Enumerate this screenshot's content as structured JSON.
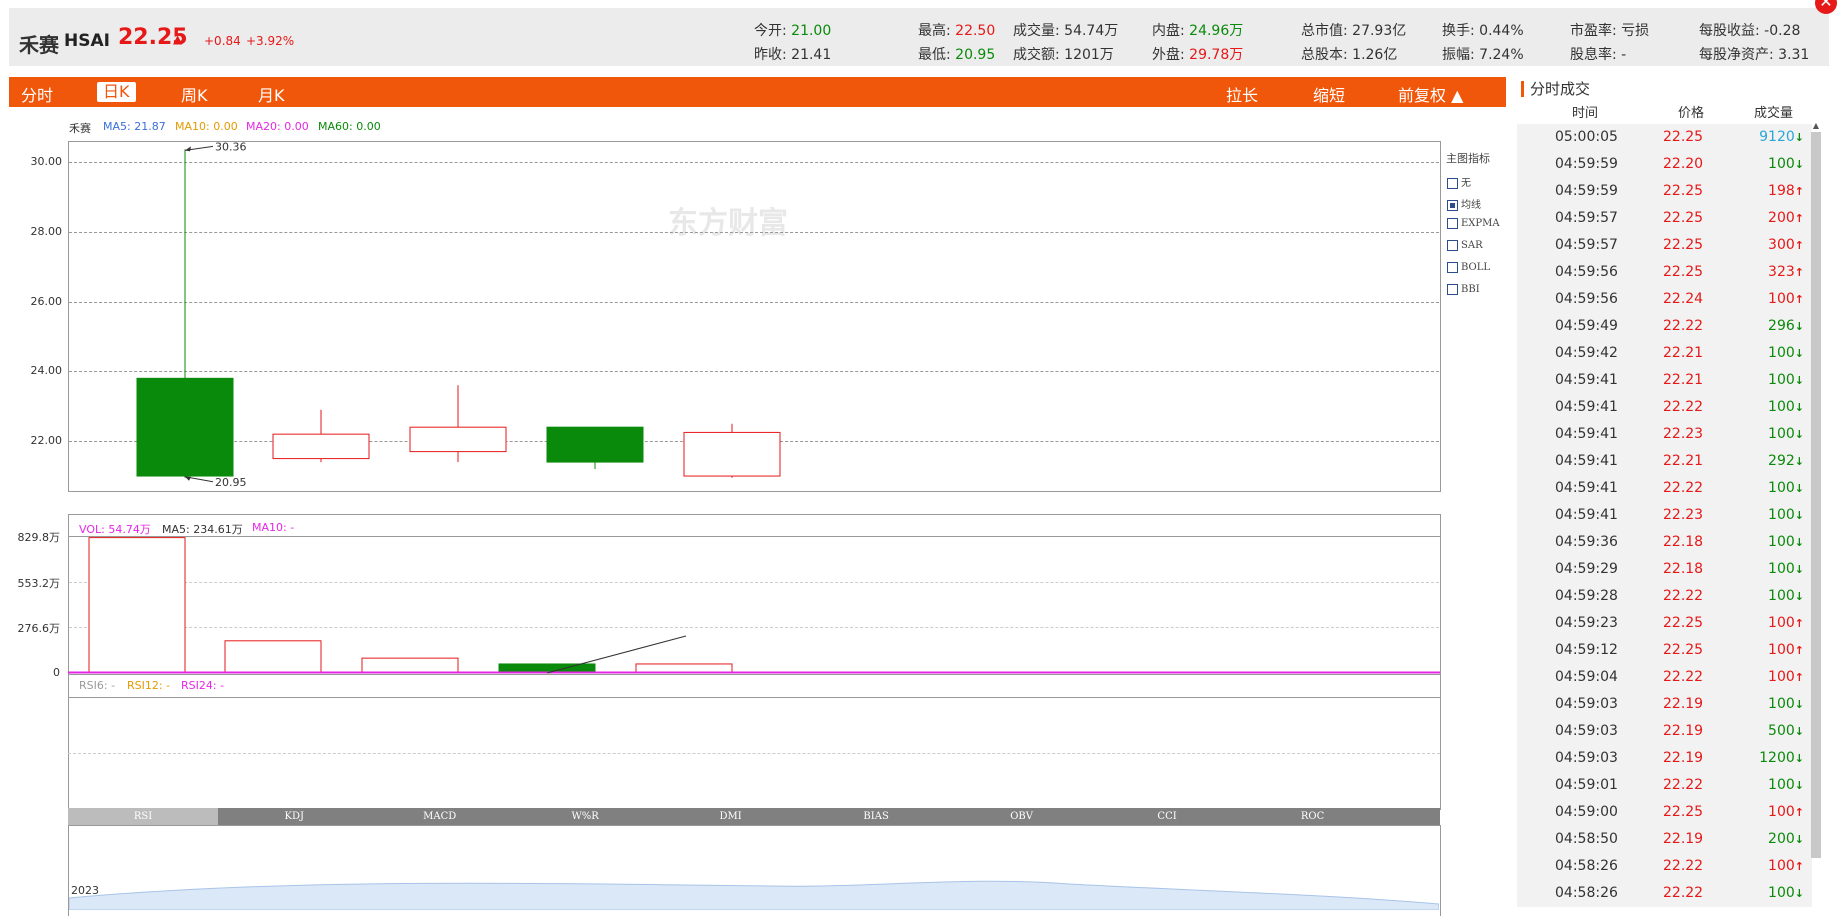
{
  "header": {
    "name": "禾赛",
    "code": "HSAI",
    "price": "22.25",
    "arrow": "▲",
    "change": "+0.84",
    "change_pct": "+3.92%",
    "stats": [
      {
        "label": "今开:",
        "value": "21.00",
        "color": "green"
      },
      {
        "label": "昨收:",
        "value": "21.41",
        "color": "black"
      },
      {
        "label": "最高:",
        "value": "22.50",
        "color": "red"
      },
      {
        "label": "最低:",
        "value": "20.95",
        "color": "green"
      },
      {
        "label": "成交量:",
        "value": "54.74万",
        "color": "black"
      },
      {
        "label": "成交额:",
        "value": "1201万",
        "color": "black"
      },
      {
        "label": "内盘:",
        "value": "24.96万",
        "color": "green"
      },
      {
        "label": "外盘:",
        "value": "29.78万",
        "color": "red"
      },
      {
        "label": "总市值:",
        "value": "27.93亿",
        "color": "black"
      },
      {
        "label": "总股本:",
        "value": "1.26亿",
        "color": "black"
      },
      {
        "label": "换手:",
        "value": "0.44%",
        "color": "black"
      },
      {
        "label": "振幅:",
        "value": "7.24%",
        "color": "black"
      },
      {
        "label": "市盈率:",
        "value": "亏损",
        "color": "black"
      },
      {
        "label": "股息率:",
        "value": "-",
        "color": "black"
      },
      {
        "label": "每股收益:",
        "value": "-0.28",
        "color": "black"
      },
      {
        "label": "每股净资产:",
        "value": "3.31",
        "color": "black"
      }
    ]
  },
  "close_icon": "✕",
  "tabs": {
    "left": [
      "分时",
      "日K",
      "周K",
      "月K"
    ],
    "active": "日K",
    "right": [
      "拉长",
      "缩短",
      "前复权 ▲"
    ]
  },
  "ma_legend": {
    "name": "禾赛",
    "ma5": "MA5: 21.87",
    "ma10": "MA10: 0.00",
    "ma20": "MA20: 0.00",
    "ma60": "MA60: 0.00"
  },
  "watermark": "东方财富",
  "price_axis": [
    "30.00",
    "28.00",
    "26.00",
    "24.00",
    "22.00"
  ],
  "high_label": "30.36",
  "low_label": "20.95",
  "main_indicators": {
    "title": "主图指标",
    "options": [
      {
        "label": "无",
        "checked": false
      },
      {
        "label": "均线",
        "checked": true
      },
      {
        "label": "EXPMA",
        "checked": false
      },
      {
        "label": "SAR",
        "checked": false
      },
      {
        "label": "BOLL",
        "checked": false
      },
      {
        "label": "BBI",
        "checked": false
      }
    ]
  },
  "vol_legend": {
    "vol": "VOL: 54.74万",
    "ma5": "MA5: 234.61万",
    "ma10": "MA10: -"
  },
  "vol_axis": [
    "829.8万",
    "553.2万",
    "276.6万",
    "0"
  ],
  "rsi_legend": {
    "rsi6": "RSI6: -",
    "rsi12": "RSI12: -",
    "rsi24": "RSI24: -"
  },
  "indicator_tabs": [
    "RSI",
    "KDJ",
    "MACD",
    "W%R",
    "DMI",
    "BIAS",
    "OBV",
    "CCI",
    "ROC"
  ],
  "indicator_active": "RSI",
  "nav_year": "2023",
  "chart_data": [
    {
      "type": "candlestick",
      "title": "",
      "ylim": [
        20.6,
        30.6
      ],
      "candles": [
        {
          "open": 23.8,
          "close": 21.0,
          "high": 30.36,
          "low": 20.95,
          "color": "green"
        },
        {
          "open": 21.5,
          "close": 22.2,
          "high": 22.9,
          "low": 21.4,
          "color": "red"
        },
        {
          "open": 21.7,
          "close": 22.4,
          "high": 23.6,
          "low": 21.4,
          "color": "red"
        },
        {
          "open": 22.4,
          "close": 21.4,
          "high": 22.4,
          "low": 21.2,
          "color": "green"
        },
        {
          "open": 21.0,
          "close": 22.25,
          "high": 22.5,
          "low": 20.95,
          "color": "red"
        }
      ]
    },
    {
      "type": "bar",
      "title": "VOL",
      "unit": "万",
      "ylim": [
        0,
        829.8
      ],
      "values": [
        820,
        195,
        90,
        54.74,
        54.74
      ],
      "colors": [
        "red",
        "red",
        "red",
        "green",
        "red"
      ]
    }
  ],
  "trades": {
    "title": "分时成交",
    "headers": [
      "时间",
      "价格",
      "成交量"
    ],
    "rows": [
      {
        "time": "05:00:05",
        "price": "22.25",
        "vol": "9120",
        "dir": "down",
        "vcolor": "blue"
      },
      {
        "time": "04:59:59",
        "price": "22.20",
        "vol": "100",
        "dir": "down",
        "vcolor": "green"
      },
      {
        "time": "04:59:59",
        "price": "22.25",
        "vol": "198",
        "dir": "up",
        "vcolor": "red"
      },
      {
        "time": "04:59:57",
        "price": "22.25",
        "vol": "200",
        "dir": "up",
        "vcolor": "red"
      },
      {
        "time": "04:59:57",
        "price": "22.25",
        "vol": "300",
        "dir": "up",
        "vcolor": "red"
      },
      {
        "time": "04:59:56",
        "price": "22.25",
        "vol": "323",
        "dir": "up",
        "vcolor": "red"
      },
      {
        "time": "04:59:56",
        "price": "22.24",
        "vol": "100",
        "dir": "up",
        "vcolor": "red"
      },
      {
        "time": "04:59:49",
        "price": "22.22",
        "vol": "296",
        "dir": "down",
        "vcolor": "green"
      },
      {
        "time": "04:59:42",
        "price": "22.21",
        "vol": "100",
        "dir": "down",
        "vcolor": "green"
      },
      {
        "time": "04:59:41",
        "price": "22.21",
        "vol": "100",
        "dir": "down",
        "vcolor": "green"
      },
      {
        "time": "04:59:41",
        "price": "22.22",
        "vol": "100",
        "dir": "down",
        "vcolor": "green"
      },
      {
        "time": "04:59:41",
        "price": "22.23",
        "vol": "100",
        "dir": "down",
        "vcolor": "green"
      },
      {
        "time": "04:59:41",
        "price": "22.21",
        "vol": "292",
        "dir": "down",
        "vcolor": "green"
      },
      {
        "time": "04:59:41",
        "price": "22.22",
        "vol": "100",
        "dir": "down",
        "vcolor": "green"
      },
      {
        "time": "04:59:41",
        "price": "22.23",
        "vol": "100",
        "dir": "down",
        "vcolor": "green"
      },
      {
        "time": "04:59:36",
        "price": "22.18",
        "vol": "100",
        "dir": "down",
        "vcolor": "green"
      },
      {
        "time": "04:59:29",
        "price": "22.18",
        "vol": "100",
        "dir": "down",
        "vcolor": "green"
      },
      {
        "time": "04:59:28",
        "price": "22.22",
        "vol": "100",
        "dir": "down",
        "vcolor": "green"
      },
      {
        "time": "04:59:23",
        "price": "22.25",
        "vol": "100",
        "dir": "up",
        "vcolor": "red"
      },
      {
        "time": "04:59:12",
        "price": "22.25",
        "vol": "100",
        "dir": "up",
        "vcolor": "red"
      },
      {
        "time": "04:59:04",
        "price": "22.22",
        "vol": "100",
        "dir": "up",
        "vcolor": "red"
      },
      {
        "time": "04:59:03",
        "price": "22.19",
        "vol": "100",
        "dir": "down",
        "vcolor": "green"
      },
      {
        "time": "04:59:03",
        "price": "22.19",
        "vol": "500",
        "dir": "down",
        "vcolor": "green"
      },
      {
        "time": "04:59:03",
        "price": "22.19",
        "vol": "1200",
        "dir": "down",
        "vcolor": "green"
      },
      {
        "time": "04:59:01",
        "price": "22.22",
        "vol": "100",
        "dir": "down",
        "vcolor": "green"
      },
      {
        "time": "04:59:00",
        "price": "22.25",
        "vol": "100",
        "dir": "up",
        "vcolor": "red"
      },
      {
        "time": "04:58:50",
        "price": "22.19",
        "vol": "200",
        "dir": "down",
        "vcolor": "green"
      },
      {
        "time": "04:58:26",
        "price": "22.22",
        "vol": "100",
        "dir": "up",
        "vcolor": "red"
      },
      {
        "time": "04:58:26",
        "price": "22.22",
        "vol": "100",
        "dir": "down",
        "vcolor": "green"
      }
    ]
  },
  "colors": {
    "up": "#e61818",
    "down": "#0a8a0a",
    "accent": "#f0570a",
    "blue": "#2aa7d8",
    "ma5": "#3a6fd8",
    "ma10": "#e59a00",
    "ma20": "#e626e6",
    "ma60": "#0a8a0a"
  }
}
